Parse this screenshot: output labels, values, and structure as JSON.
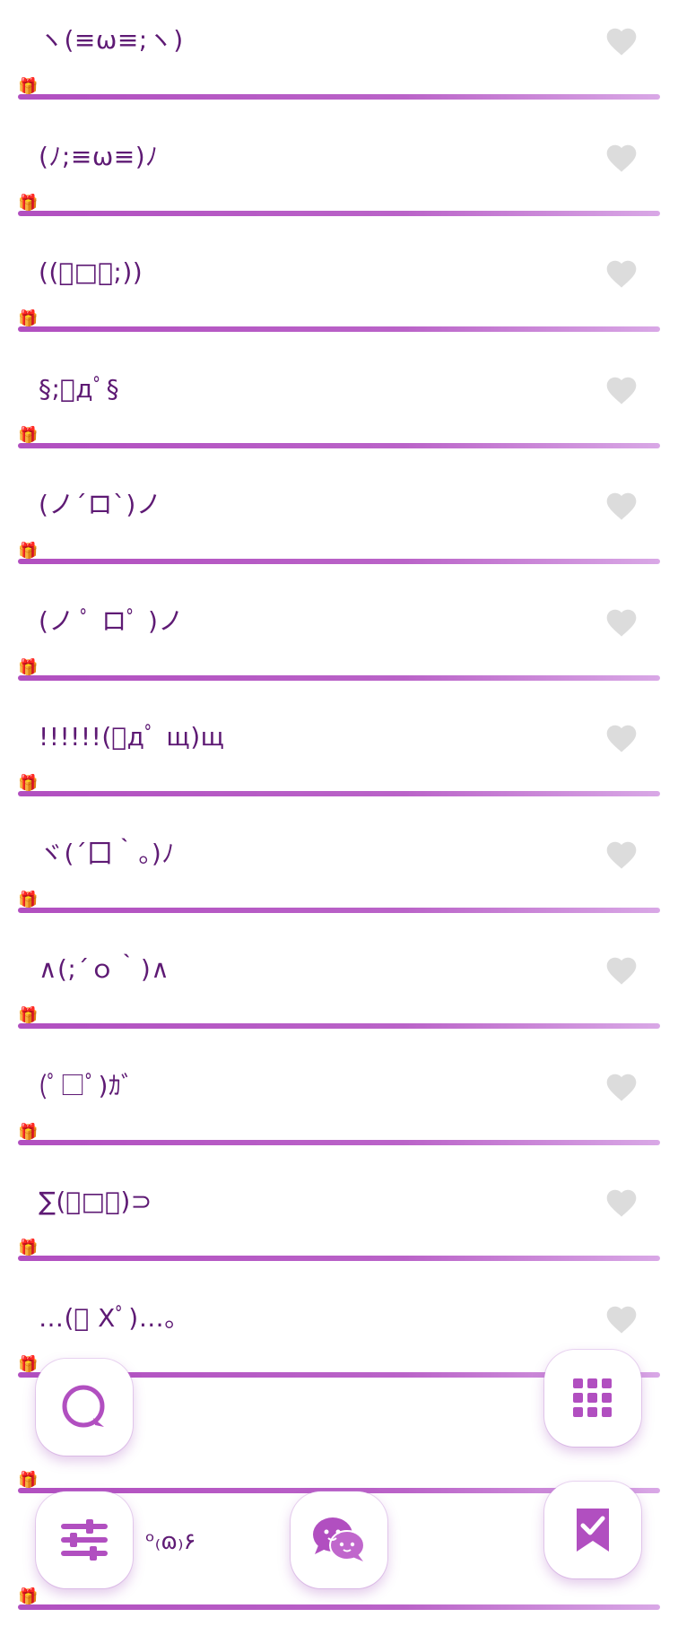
{
  "kaomoji_list": {
    "items": [
      {
        "text": "ヽ(≡ω≡;ヽ)"
      },
      {
        "text": "(ﾉ;≡ω≡)ﾉ"
      },
      {
        "text": "((ﾟ□ﾟ;))"
      },
      {
        "text": "§;ﾟдﾟ§"
      },
      {
        "text": "(ノ´ロ`)ノ"
      },
      {
        "text": "(ノ ﾟ ロﾟ )ノ"
      },
      {
        "text": "!!!!!!(ﾟдﾟ щ)щ"
      },
      {
        "text": "ヾ(´囗｀。)ﾉ"
      },
      {
        "text": "∧(;´ｏ｀)∧"
      },
      {
        "text": "(ﾟ□ﾟ)ｶﾞ"
      },
      {
        "text": "∑(ﾟ□ﾟ)⊃"
      },
      {
        "text": "…(ﾟ Xﾟ)…。"
      },
      {
        "text": ""
      },
      {
        "text": ""
      }
    ]
  },
  "partial_text": "ᵒ₍ɷ₎۶",
  "icons": {
    "heart": "heart-icon",
    "gift": "gift-icon",
    "search": "search-chat-icon",
    "grid": "grid-icon",
    "settings": "sliders-icon",
    "chat": "chat-bubbles-icon",
    "bookmark": "bookmark-check-icon"
  },
  "colors": {
    "accent": "#b14fc0",
    "text": "#5e1a74",
    "heart_inactive": "#dcdcdc"
  }
}
